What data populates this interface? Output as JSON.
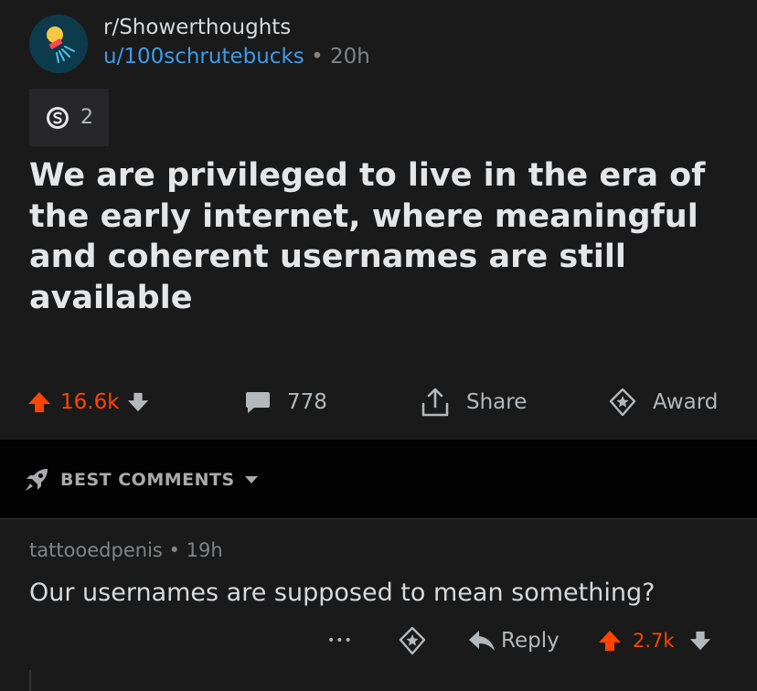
{
  "post": {
    "subreddit": "r/Showerthoughts",
    "author": "u/100schrutebucks",
    "separator": " • ",
    "age": "20h",
    "award_count": "2",
    "title": "We are privileged to live in the era of the early internet, where meaningful and coherent usernames are still available",
    "actions": {
      "score": "16.6k",
      "comments": "778",
      "share": "Share",
      "award": "Award"
    }
  },
  "sort": {
    "label": "BEST COMMENTS"
  },
  "comment": {
    "author": "tattooedpenis",
    "separator": " • ",
    "age": "19h",
    "body": "Our usernames are supposed to mean something?",
    "more": "•••",
    "reply": "Reply",
    "score": "2.7k"
  },
  "colors": {
    "background": "#1a1a1b",
    "sort_bar": "#030303",
    "upvote": "#ff4500",
    "author_link": "#3d9be9",
    "muted": "#818384"
  },
  "icons": [
    "subreddit-avatar-icon",
    "silver-award-icon",
    "upvote-icon",
    "downvote-icon",
    "comment-icon",
    "share-icon",
    "award-icon",
    "rocket-icon",
    "chevron-down-icon",
    "more-icon",
    "reply-icon"
  ]
}
